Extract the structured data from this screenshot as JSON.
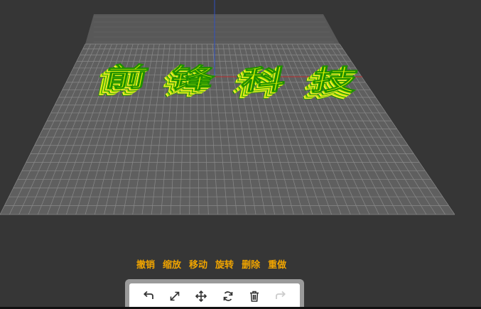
{
  "scene": {
    "background_color": "#363636",
    "grid_color": "#8a8a8a",
    "plane_color": "#5f5f5f",
    "axis_x_color": "#c03030",
    "axis_y_color": "#3050c0",
    "model_text": "前锋科技",
    "model_colors": [
      "#1f8f00",
      "#7ad400",
      "#d6f000",
      "#ffe54a"
    ]
  },
  "actions": {
    "labels": [
      "撤销",
      "缩放",
      "移动",
      "旋转",
      "删除",
      "重做"
    ],
    "label_color": "#f0a400"
  },
  "toolbar": {
    "icons": [
      "undo-icon",
      "scale-icon",
      "move-icon",
      "rotate-icon",
      "delete-icon",
      "redo-icon"
    ],
    "icon_color": "#333333",
    "disabled_color": "#cccccc"
  }
}
